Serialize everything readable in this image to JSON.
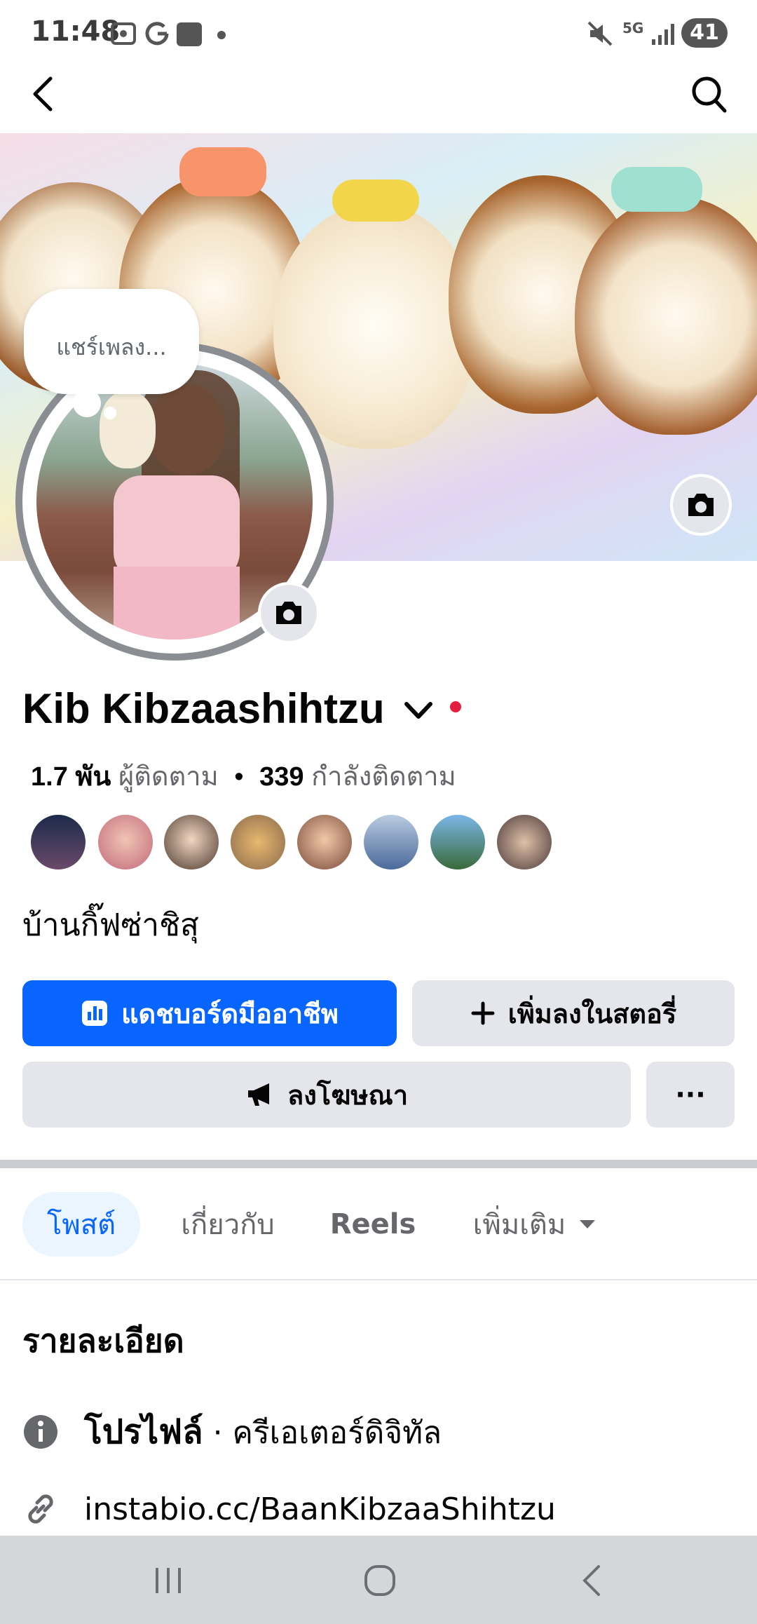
{
  "status_bar": {
    "time": "11:48",
    "network": "5G",
    "battery": "41"
  },
  "bubble": {
    "text": "แชร์เพลง..."
  },
  "profile": {
    "name": "Kib Kibzaashihtzu",
    "followers_count": "1.7 พัน",
    "followers_label": "ผู้ติดตาม",
    "following_count": "339",
    "following_label": "กำลังติดตาม",
    "bio": "บ้านกิ๊ฟซ่าชิสุ"
  },
  "buttons": {
    "dashboard": "แดชบอร์ดมืออาชีพ",
    "add_story": "เพิ่มลงในสตอรี่",
    "advertise": "ลงโฆษณา",
    "more": "···"
  },
  "tabs": [
    {
      "label": "โพสต์"
    },
    {
      "label": "เกี่ยวกับ"
    },
    {
      "label": "Reels"
    },
    {
      "label": "เพิ่มเติม"
    }
  ],
  "details": {
    "title": "รายละเอียด",
    "profile_label": "โปรไฟล์",
    "profile_category": " · ครีเอเตอร์ดิจิทัล",
    "link": "instabio.cc/BaanKibzaaShihtzu"
  },
  "colors": {
    "primary": "#0866ff",
    "button_gray": "#e4e6eb",
    "text_secondary": "#65676b",
    "tab_active_bg": "#ebf5ff"
  }
}
